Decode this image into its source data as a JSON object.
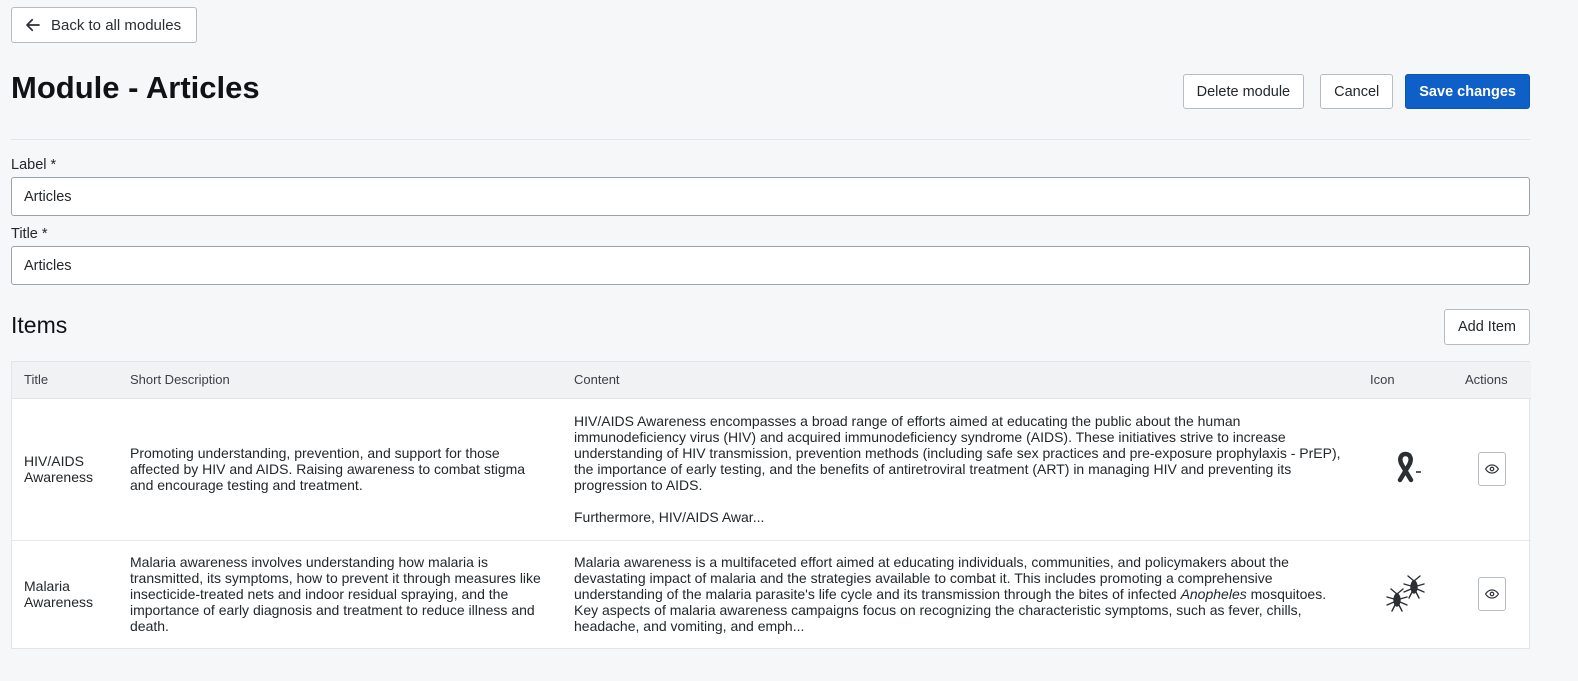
{
  "back": {
    "label": "Back to all modules"
  },
  "page": {
    "title": "Module - Articles"
  },
  "actions": {
    "delete_label": "Delete module",
    "cancel_label": "Cancel",
    "save_label": "Save changes"
  },
  "form": {
    "label": {
      "label": "Label *",
      "value": "Articles"
    },
    "title": {
      "label": "Title *",
      "value": "Articles"
    }
  },
  "items": {
    "heading": "Items",
    "add_label": "Add Item",
    "columns": {
      "title": "Title",
      "short_description": "Short Description",
      "content": "Content",
      "icon": "Icon",
      "actions": "Actions"
    },
    "rows": [
      {
        "title": "HIV/AIDS Awareness",
        "short_description": "Promoting understanding, prevention, and support for those affected by HIV and AIDS. Raising awareness to combat stigma and encourage testing and treatment.",
        "content": {
          "paragraph_1": "HIV/AIDS Awareness encompasses a broad range of efforts aimed at educating the public about the human immunodeficiency virus (HIV) and acquired immunodeficiency syndrome (AIDS). These initiatives strive to increase understanding of HIV transmission, prevention methods (including safe sex practices and pre-exposure prophylaxis - PrEP), the importance of early testing, and the benefits of antiretroviral treatment (ART) in managing HIV and preventing its progression to AIDS.",
          "paragraph_2": "Furthermore, HIV/AIDS Awar..."
        },
        "icon": "awareness-ribbon-icon"
      },
      {
        "title": "Malaria Awareness",
        "short_description": "Malaria awareness involves understanding how malaria is transmitted, its symptoms, how to prevent it through measures like insecticide-treated nets and indoor residual spraying, and the importance of early diagnosis and treatment to reduce illness and death.",
        "content": {
          "part_1": "Malaria awareness is a multifaceted effort aimed at educating individuals, communities, and policymakers about the devastating impact of malaria and the strategies available to combat it. This includes promoting a comprehensive understanding of the malaria parasite's life cycle and its transmission through the bites of infected ",
          "italic": "Anopheles",
          "part_2": " mosquitoes. Key aspects of malaria awareness campaigns focus on recognizing the characteristic symptoms, such as fever, chills, headache, and vomiting, and emph..."
        },
        "icon": "mosquito-icon"
      }
    ]
  },
  "colors": {
    "primary": "#0f5fc8",
    "background": "#f6f7f9",
    "icon": "#2b2f33"
  }
}
